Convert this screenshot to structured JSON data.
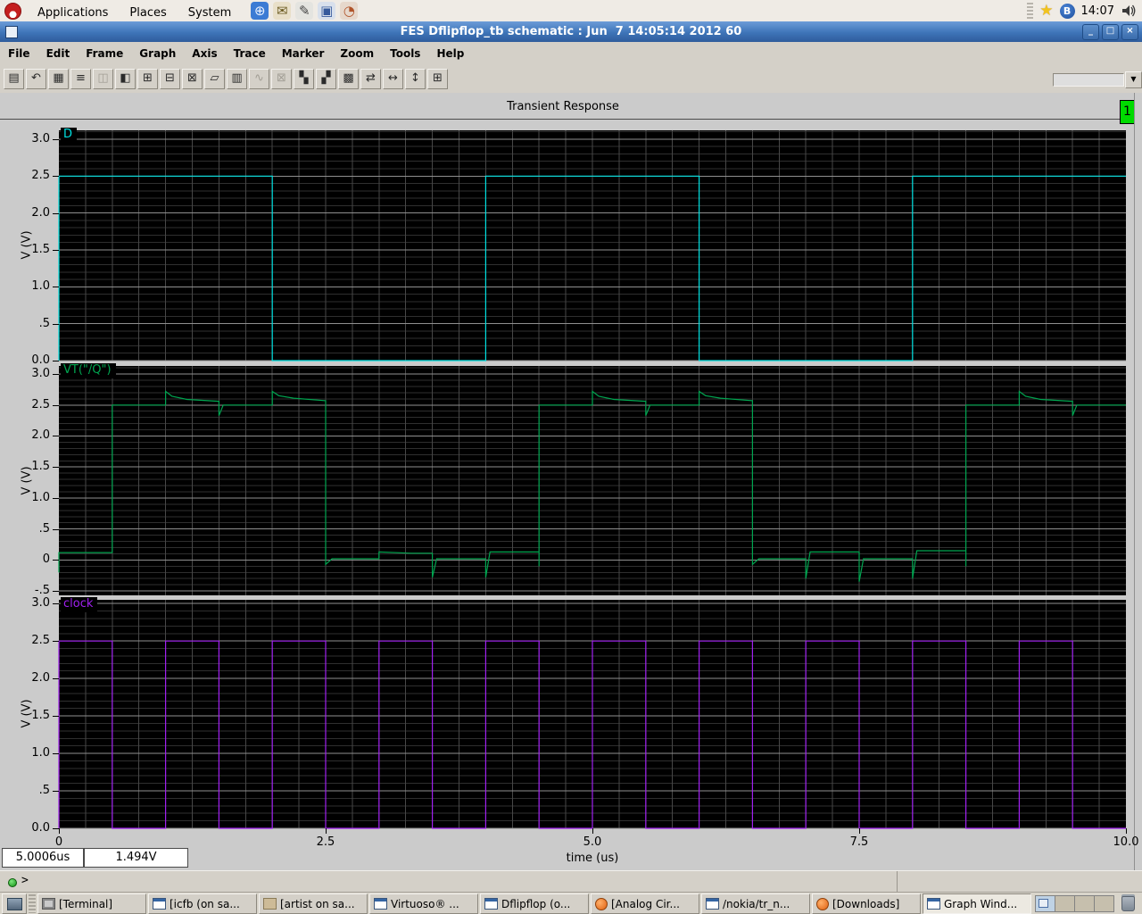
{
  "desktop": {
    "menus": [
      "Applications",
      "Places",
      "System"
    ],
    "launchers": [
      {
        "name": "web-browser",
        "glyph": "⊕",
        "bg": "#3B7BD4",
        "fg": "#EAF2FF"
      },
      {
        "name": "email",
        "glyph": "✉",
        "bg": "#E8DFC8",
        "fg": "#6a5a20"
      },
      {
        "name": "notes",
        "glyph": "✎",
        "bg": "#E4E4E0",
        "fg": "#444444"
      },
      {
        "name": "screenshot",
        "glyph": "▣",
        "bg": "#D8E0EC",
        "fg": "#365a9c"
      },
      {
        "name": "chart",
        "glyph": "◔",
        "bg": "#E6D8CC",
        "fg": "#b0542a"
      }
    ],
    "clock": "14:07",
    "bluetooth_glyph": "B",
    "star_glyph": "★"
  },
  "window": {
    "title": "FES Dflipflop_tb schematic : Jun  7 14:05:14 2012 60",
    "controls": {
      "minimize": "_",
      "maximize": "□",
      "close": "×"
    },
    "menu": [
      "File",
      "Edit",
      "Frame",
      "Graph",
      "Axis",
      "Trace",
      "Marker",
      "Zoom",
      "Tools",
      "Help"
    ],
    "toolbar": [
      {
        "name": "print",
        "glyph": "▤"
      },
      {
        "name": "undo",
        "glyph": "↶"
      },
      {
        "name": "grid",
        "glyph": "▦"
      },
      {
        "name": "strip-mode",
        "glyph": "≡"
      },
      {
        "name": "overlay-mode",
        "glyph": "◫",
        "disabled": true
      },
      {
        "name": "split-window",
        "glyph": "◧"
      },
      {
        "name": "new-subwindow",
        "glyph": "⊞"
      },
      {
        "name": "delete-subwindow",
        "glyph": "⊟"
      },
      {
        "name": "resize-subwindow",
        "glyph": "⊠"
      },
      {
        "name": "marker",
        "glyph": "▱"
      },
      {
        "name": "table",
        "glyph": "▥"
      },
      {
        "name": "wave-mode",
        "glyph": "∿",
        "disabled": true
      },
      {
        "name": "xy-mode",
        "glyph": "⊠",
        "disabled": true
      },
      {
        "name": "slice-vertical",
        "glyph": "▚"
      },
      {
        "name": "slice-horizontal",
        "glyph": "▞"
      },
      {
        "name": "calculator",
        "glyph": "▩"
      },
      {
        "name": "swap-x",
        "glyph": "⇄"
      },
      {
        "name": "fit-x",
        "glyph": "↔"
      },
      {
        "name": "fit-y",
        "glyph": "↕"
      },
      {
        "name": "zoom-fit",
        "glyph": "⊞"
      }
    ],
    "trace_swatch_color": "#A020F0",
    "swatch_drop_glyph": "▼"
  },
  "graph": {
    "title": "Transient Response",
    "page_badge": "1",
    "status_time": "5.0006us",
    "status_value": "1.494V",
    "prompt": ">"
  },
  "chart_data": {
    "type": "line",
    "title": "Transient Response",
    "xlabel": "time (us)",
    "xlim": [
      0,
      10
    ],
    "xticks": [
      0,
      2.5,
      5,
      7.5,
      10
    ],
    "xtick_labels": [
      "0",
      "2.5",
      "5.0",
      "7.5",
      "10.0"
    ],
    "grid": {
      "x_minor_step": 0.25,
      "y_minor_step": 0.1,
      "y_major_step": 0.5
    },
    "panels": [
      {
        "signal": "D",
        "color": "#00E0E0",
        "ylabel": "V (V)",
        "ylim": [
          0,
          3.12
        ],
        "yticks": [
          {
            "v": 3.0,
            "label": "3.0"
          },
          {
            "v": 2.5,
            "label": "2.5"
          },
          {
            "v": 2.0,
            "label": "2.0"
          },
          {
            "v": 1.5,
            "label": "1.5"
          },
          {
            "v": 1.0,
            "label": "1.0"
          },
          {
            "v": 0.5,
            "label": ".5"
          },
          {
            "v": 0.0,
            "label": "0.0"
          }
        ],
        "points": [
          [
            0,
            0
          ],
          [
            0,
            2.5
          ],
          [
            2,
            2.5
          ],
          [
            2,
            0
          ],
          [
            4,
            0
          ],
          [
            4,
            2.5
          ],
          [
            6,
            2.5
          ],
          [
            6,
            0
          ],
          [
            8,
            0
          ],
          [
            8,
            2.5
          ],
          [
            10,
            2.5
          ]
        ]
      },
      {
        "signal": "VT(\"/Q\")",
        "color": "#00A550",
        "ylabel": "V (V)",
        "ylim": [
          -0.57,
          3.13
        ],
        "yticks": [
          {
            "v": 3.0,
            "label": "3.0"
          },
          {
            "v": 2.5,
            "label": "2.5"
          },
          {
            "v": 2.0,
            "label": "2.0"
          },
          {
            "v": 1.5,
            "label": "1.5"
          },
          {
            "v": 1.0,
            "label": "1.0"
          },
          {
            "v": 0.5,
            "label": ".5"
          },
          {
            "v": 0.0,
            "label": "0"
          },
          {
            "v": -0.5,
            "label": "-.5"
          }
        ],
        "points": [
          [
            0,
            -0.2
          ],
          [
            0,
            0.12
          ],
          [
            0.5,
            0.12
          ],
          [
            0.5,
            2.5
          ],
          [
            1,
            2.5
          ],
          [
            1,
            2.72
          ],
          [
            1.06,
            2.64
          ],
          [
            1.2,
            2.59
          ],
          [
            1.5,
            2.56
          ],
          [
            1.5,
            2.33
          ],
          [
            1.54,
            2.5
          ],
          [
            2,
            2.5
          ],
          [
            2,
            2.72
          ],
          [
            2.06,
            2.65
          ],
          [
            2.2,
            2.61
          ],
          [
            2.5,
            2.57
          ],
          [
            2.5,
            -0.07
          ],
          [
            2.56,
            0.02
          ],
          [
            3,
            0.02
          ],
          [
            3,
            0.13
          ],
          [
            3.3,
            0.11
          ],
          [
            3.5,
            0.11
          ],
          [
            3.5,
            -0.28
          ],
          [
            3.54,
            0.02
          ],
          [
            4,
            0.02
          ],
          [
            4,
            -0.28
          ],
          [
            4.04,
            0.13
          ],
          [
            4.5,
            0.13
          ],
          [
            4.5,
            -0.1
          ],
          [
            4.5,
            2.5
          ],
          [
            5,
            2.5
          ],
          [
            5,
            2.72
          ],
          [
            5.06,
            2.64
          ],
          [
            5.2,
            2.59
          ],
          [
            5.5,
            2.56
          ],
          [
            5.5,
            2.33
          ],
          [
            5.54,
            2.5
          ],
          [
            6,
            2.5
          ],
          [
            6,
            2.72
          ],
          [
            6.06,
            2.65
          ],
          [
            6.2,
            2.61
          ],
          [
            6.5,
            2.57
          ],
          [
            6.5,
            -0.07
          ],
          [
            6.56,
            0.02
          ],
          [
            7,
            0.02
          ],
          [
            7,
            -0.3
          ],
          [
            7.04,
            0.13
          ],
          [
            7.5,
            0.13
          ],
          [
            7.5,
            -0.35
          ],
          [
            7.54,
            0.02
          ],
          [
            8,
            0.02
          ],
          [
            8,
            -0.3
          ],
          [
            8.04,
            0.15
          ],
          [
            8.5,
            0.15
          ],
          [
            8.5,
            -0.1
          ],
          [
            8.5,
            2.5
          ],
          [
            9,
            2.5
          ],
          [
            9,
            2.72
          ],
          [
            9.06,
            2.64
          ],
          [
            9.2,
            2.59
          ],
          [
            9.5,
            2.56
          ],
          [
            9.5,
            2.33
          ],
          [
            9.54,
            2.5
          ],
          [
            10,
            2.5
          ]
        ]
      },
      {
        "signal": "clock",
        "color": "#A020F0",
        "ylabel": "V (V)",
        "ylim": [
          0,
          3.05
        ],
        "yticks": [
          {
            "v": 3.0,
            "label": "3.0"
          },
          {
            "v": 2.5,
            "label": "2.5"
          },
          {
            "v": 2.0,
            "label": "2.0"
          },
          {
            "v": 1.5,
            "label": "1.5"
          },
          {
            "v": 1.0,
            "label": "1.0"
          },
          {
            "v": 0.5,
            "label": ".5"
          },
          {
            "v": 0.0,
            "label": "0.0"
          }
        ],
        "points": [
          [
            0,
            0
          ],
          [
            0,
            2.5
          ],
          [
            0.5,
            2.5
          ],
          [
            0.5,
            0
          ],
          [
            1,
            0
          ],
          [
            1,
            2.5
          ],
          [
            1.5,
            2.5
          ],
          [
            1.5,
            0
          ],
          [
            2,
            0
          ],
          [
            2,
            2.5
          ],
          [
            2.5,
            2.5
          ],
          [
            2.5,
            0
          ],
          [
            3,
            0
          ],
          [
            3,
            2.5
          ],
          [
            3.5,
            2.5
          ],
          [
            3.5,
            0
          ],
          [
            4,
            0
          ],
          [
            4,
            2.5
          ],
          [
            4.5,
            2.5
          ],
          [
            4.5,
            0
          ],
          [
            5,
            0
          ],
          [
            5,
            2.5
          ],
          [
            5.5,
            2.5
          ],
          [
            5.5,
            0
          ],
          [
            6,
            0
          ],
          [
            6,
            2.5
          ],
          [
            6.5,
            2.5
          ],
          [
            6.5,
            0
          ],
          [
            7,
            0
          ],
          [
            7,
            2.5
          ],
          [
            7.5,
            2.5
          ],
          [
            7.5,
            0
          ],
          [
            8,
            0
          ],
          [
            8,
            2.5
          ],
          [
            8.5,
            2.5
          ],
          [
            8.5,
            0
          ],
          [
            9,
            0
          ],
          [
            9,
            2.5
          ],
          [
            9.5,
            2.5
          ],
          [
            9.5,
            0
          ],
          [
            10,
            0
          ]
        ]
      }
    ]
  },
  "taskbar": {
    "items": [
      {
        "icon": "terminal",
        "label": "[Terminal]"
      },
      {
        "icon": "window",
        "label": "[icfb (on sa..."
      },
      {
        "icon": "package",
        "label": "[artist on sa..."
      },
      {
        "icon": "window",
        "label": "Virtuoso® ..."
      },
      {
        "icon": "window",
        "label": "Dflipflop (o..."
      },
      {
        "icon": "firefox",
        "label": "[Analog Cir..."
      },
      {
        "icon": "window",
        "label": "/nokia/tr_n..."
      },
      {
        "icon": "firefox",
        "label": "[Downloads]"
      },
      {
        "icon": "window",
        "label": "Graph Wind...",
        "active": true
      }
    ],
    "workspace_count": 4
  }
}
